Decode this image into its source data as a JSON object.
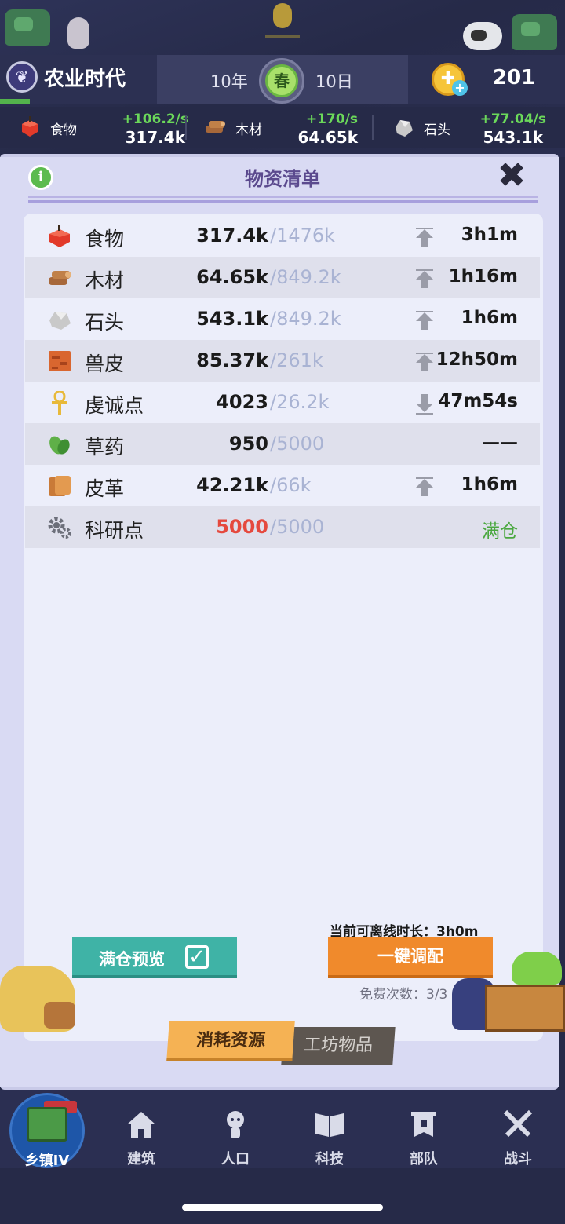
{
  "header": {
    "era_title": "农业时代",
    "year": "10年",
    "season": "春",
    "day": "10日",
    "coins": "201"
  },
  "resource_strip": [
    {
      "name": "食物",
      "rate": "+106.2/s",
      "value": "317.4k",
      "icon": "apple-icon"
    },
    {
      "name": "木材",
      "rate": "+170/s",
      "value": "64.65k",
      "icon": "wood-icon"
    },
    {
      "name": "石头",
      "rate": "+77.04/s",
      "value": "543.1k",
      "icon": "stone-icon"
    }
  ],
  "panel": {
    "title": "物资清单",
    "info_glyph": "i",
    "close_glyph": "✖"
  },
  "inventory": [
    {
      "name": "食物",
      "current": "317.4k",
      "capacity": "/1476k",
      "trend": "up",
      "time": "3h1m",
      "icon": "apple-icon"
    },
    {
      "name": "木材",
      "current": "64.65k",
      "capacity": "/849.2k",
      "trend": "up",
      "time": "1h16m",
      "icon": "wood-icon"
    },
    {
      "name": "石头",
      "current": "543.1k",
      "capacity": "/849.2k",
      "trend": "up",
      "time": "1h6m",
      "icon": "stone-icon"
    },
    {
      "name": "兽皮",
      "current": "85.37k",
      "capacity": "/261k",
      "trend": "up",
      "time": "12h50m",
      "icon": "hide-icon"
    },
    {
      "name": "虔诚点",
      "current": "4023",
      "capacity": "/26.2k",
      "trend": "down",
      "time": "47m54s",
      "icon": "ankh-icon"
    },
    {
      "name": "草药",
      "current": "950",
      "capacity": "/5000",
      "trend": "none",
      "time": "——",
      "icon": "herb-icon"
    },
    {
      "name": "皮革",
      "current": "42.21k",
      "capacity": "/66k",
      "trend": "up",
      "time": "1h6m",
      "icon": "leather-icon"
    },
    {
      "name": "科研点",
      "current": "5000",
      "capacity": "/5000",
      "trend": "none",
      "time": "满仓",
      "icon": "gears-icon"
    }
  ],
  "actions": {
    "offline_text": "当前可离线时长：3h0m",
    "preview_label": "满仓预览",
    "auto_label": "一键调配",
    "free_count": "免费次数：3/3"
  },
  "tabs": {
    "consume": "消耗资源",
    "workshop": "工坊物品"
  },
  "bottom_nav": [
    {
      "label": "乡镇IV",
      "icon": "castle-icon"
    },
    {
      "label": "建筑",
      "icon": "house-icon"
    },
    {
      "label": "人口",
      "icon": "person-icon"
    },
    {
      "label": "科技",
      "icon": "book-icon"
    },
    {
      "label": "部队",
      "icon": "banner-icon"
    },
    {
      "label": "战斗",
      "icon": "swords-icon"
    }
  ],
  "colors": {
    "full_red": "#e5493e",
    "rate_green": "#6bd85a",
    "ok_green": "#4aa83f",
    "teal_button": "#3fb3a6",
    "orange_button": "#f08a2c"
  }
}
